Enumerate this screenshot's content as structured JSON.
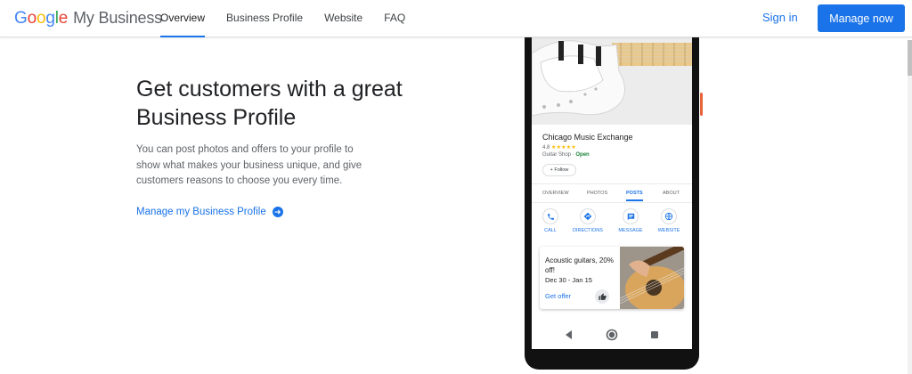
{
  "header": {
    "logo_google_letters": [
      "G",
      "o",
      "o",
      "g",
      "l",
      "e"
    ],
    "logo_product": "My Business",
    "nav": [
      {
        "label": "Overview",
        "active": true
      },
      {
        "label": "Business Profile",
        "active": false
      },
      {
        "label": "Website",
        "active": false
      },
      {
        "label": "FAQ",
        "active": false
      }
    ],
    "sign_in": "Sign in",
    "manage_now": "Manage now"
  },
  "hero": {
    "title": "Get customers with a great Business Profile",
    "description": "You can post photos and offers to your profile to show what makes your business unique, and give customers reasons to choose you every time.",
    "link": "Manage my Business Profile"
  },
  "phone": {
    "business_name": "Chicago Music Exchange",
    "rating_value": "4.8",
    "rating_stars": "★★★★★",
    "category": "Guitar Shop · ",
    "status": "Open",
    "follow": "+ Follow",
    "tabs": [
      {
        "label": "OVERVIEW",
        "active": false
      },
      {
        "label": "PHOTOS",
        "active": false
      },
      {
        "label": "POSTS",
        "active": true
      },
      {
        "label": "ABOUT",
        "active": false
      }
    ],
    "actions": [
      {
        "label": "CALL",
        "icon": "phone-icon"
      },
      {
        "label": "DIRECTIONS",
        "icon": "directions-icon"
      },
      {
        "label": "MESSAGE",
        "icon": "message-icon"
      },
      {
        "label": "WEBSITE",
        "icon": "globe-icon"
      }
    ],
    "offer": {
      "title": "Acoustic guitars, 20% off!",
      "dates": "Dec 30 - Jan 15",
      "cta": "Get offer"
    }
  },
  "colors": {
    "accent": "#1a73e8",
    "open_status": "#188038",
    "star": "#fbbc04"
  }
}
